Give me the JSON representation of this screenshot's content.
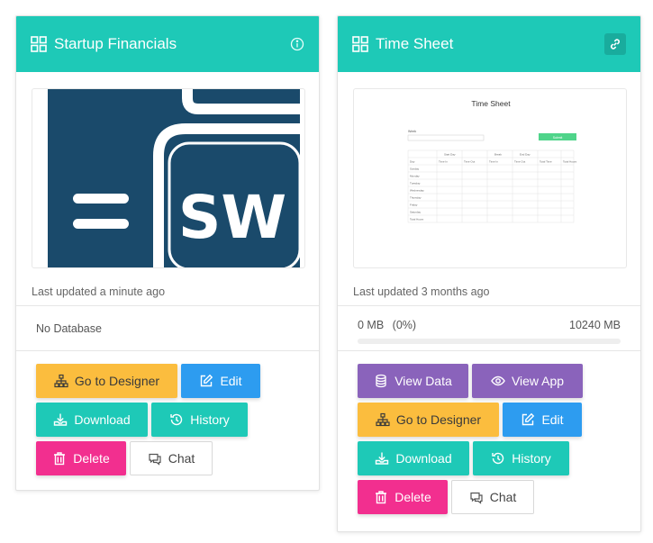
{
  "cards": [
    {
      "title": "Startup Financials",
      "thumbnail_text": "SW",
      "updated": "Last updated a minute ago",
      "database": "No Database",
      "buttons": {
        "designer": "Go to Designer",
        "edit": "Edit",
        "download": "Download",
        "history": "History",
        "delete": "Delete",
        "chat": "Chat"
      },
      "header_icon": "info-icon"
    },
    {
      "title": "Time Sheet",
      "thumbnail": {
        "title": "Time Sheet",
        "label": "Week",
        "button": "Submit",
        "groups": [
          "Start Day",
          "Break",
          "End Day"
        ],
        "columns": [
          "Day",
          "Time In",
          "Time Out",
          "Time In",
          "Time Out",
          "Total Time",
          "Total Hours"
        ],
        "days": [
          "Sunday",
          "Monday",
          "Tuesday",
          "Wednesday",
          "Thursday",
          "Friday",
          "Saturday",
          "Total Hours"
        ]
      },
      "updated": "Last updated 3 months ago",
      "storage": {
        "used": "0 MB",
        "percent_label": "(0%)",
        "total": "10240 MB",
        "percent": 0
      },
      "buttons": {
        "view_data": "View Data",
        "view_app": "View App",
        "designer": "Go to Designer",
        "edit": "Edit",
        "download": "Download",
        "history": "History",
        "delete": "Delete",
        "chat": "Chat"
      },
      "header_icon": "link-icon"
    }
  ],
  "colors": {
    "header": "#1ec9b7",
    "purple": "#8a63bb",
    "yellow": "#fbbd3e",
    "blue": "#2d9cf0",
    "teal": "#1ec9b7",
    "pink": "#f22f8f",
    "logo_navy": "#1a4a6b"
  }
}
